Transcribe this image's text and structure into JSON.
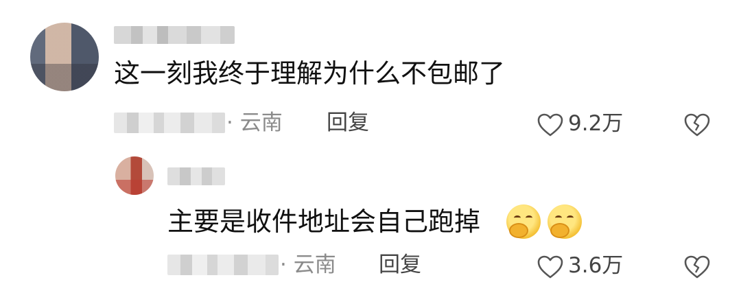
{
  "comments": [
    {
      "text": "这一刻我终于理解为什么不包邮了",
      "location": "· 云南",
      "reply_label": "回复",
      "likes": "9.2万"
    },
    {
      "text": "主要是收件地址会自己跑掉",
      "location": "· 云南",
      "reply_label": "回复",
      "likes": "3.6万"
    }
  ],
  "icons": {
    "like": "heart-outline-icon",
    "dislike": "broken-heart-icon",
    "emoji": "hand-over-mouth-emoji"
  },
  "colors": {
    "text": "#111111",
    "meta": "#8b8b8b",
    "icon": "#555555"
  }
}
